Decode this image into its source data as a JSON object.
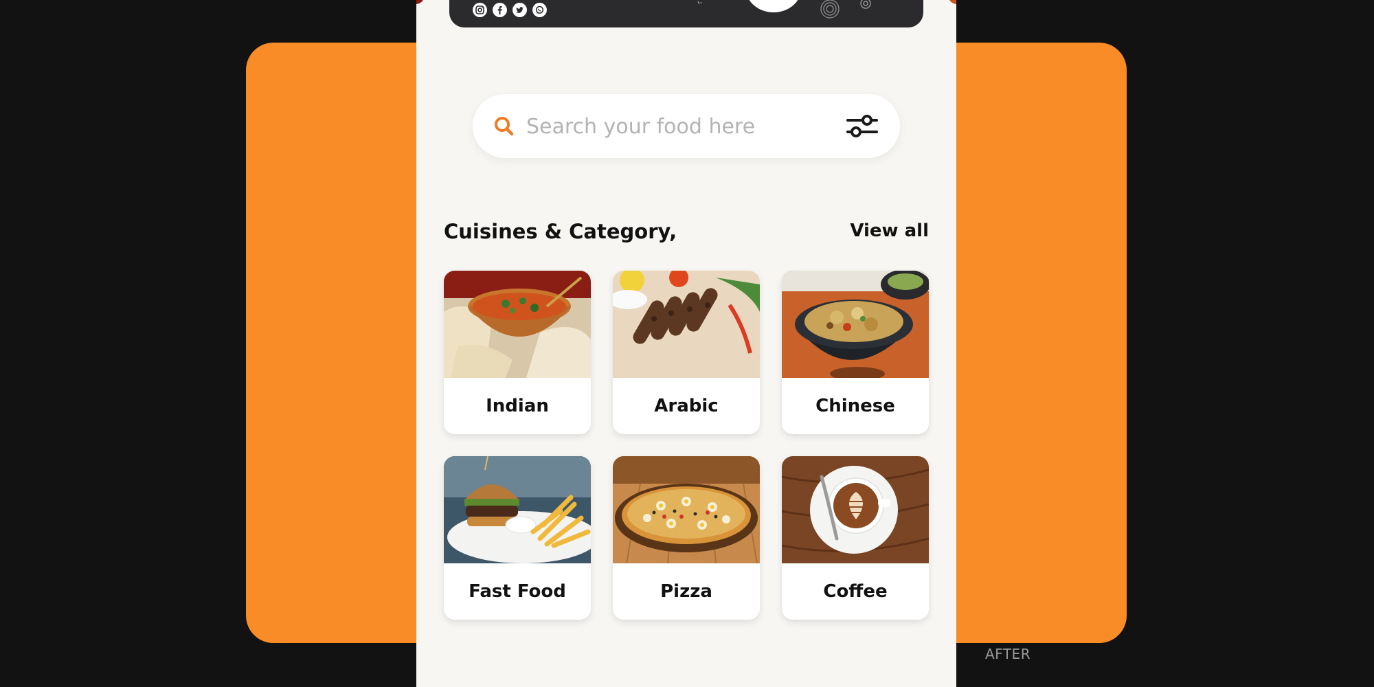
{
  "colors": {
    "page_background": "#121212",
    "panel_orange": "#F98C26",
    "phone_background": "#F7F6F3",
    "banner_dark": "#2B2B2E",
    "accent": "#F07A22"
  },
  "caption": "AFTER",
  "banner": {
    "social_icons": [
      "instagram-icon",
      "facebook-icon",
      "twitter-icon",
      "whatsapp-icon"
    ]
  },
  "search": {
    "placeholder": "Search your food here",
    "value": "",
    "icon": "search-icon",
    "filter_icon": "sliders-filter-icon"
  },
  "section": {
    "title": "Cuisines & Category,",
    "view_all_label": "View all"
  },
  "categories": [
    {
      "label": "Indian",
      "image": "indian-curry-naan-photo"
    },
    {
      "label": "Arabic",
      "image": "arabic-kebab-photo"
    },
    {
      "label": "Chinese",
      "image": "chinese-stirfry-pot-photo"
    },
    {
      "label": "Fast Food",
      "image": "burger-fries-photo"
    },
    {
      "label": "Pizza",
      "image": "pizza-photo"
    },
    {
      "label": "Coffee",
      "image": "latte-cup-photo"
    }
  ]
}
